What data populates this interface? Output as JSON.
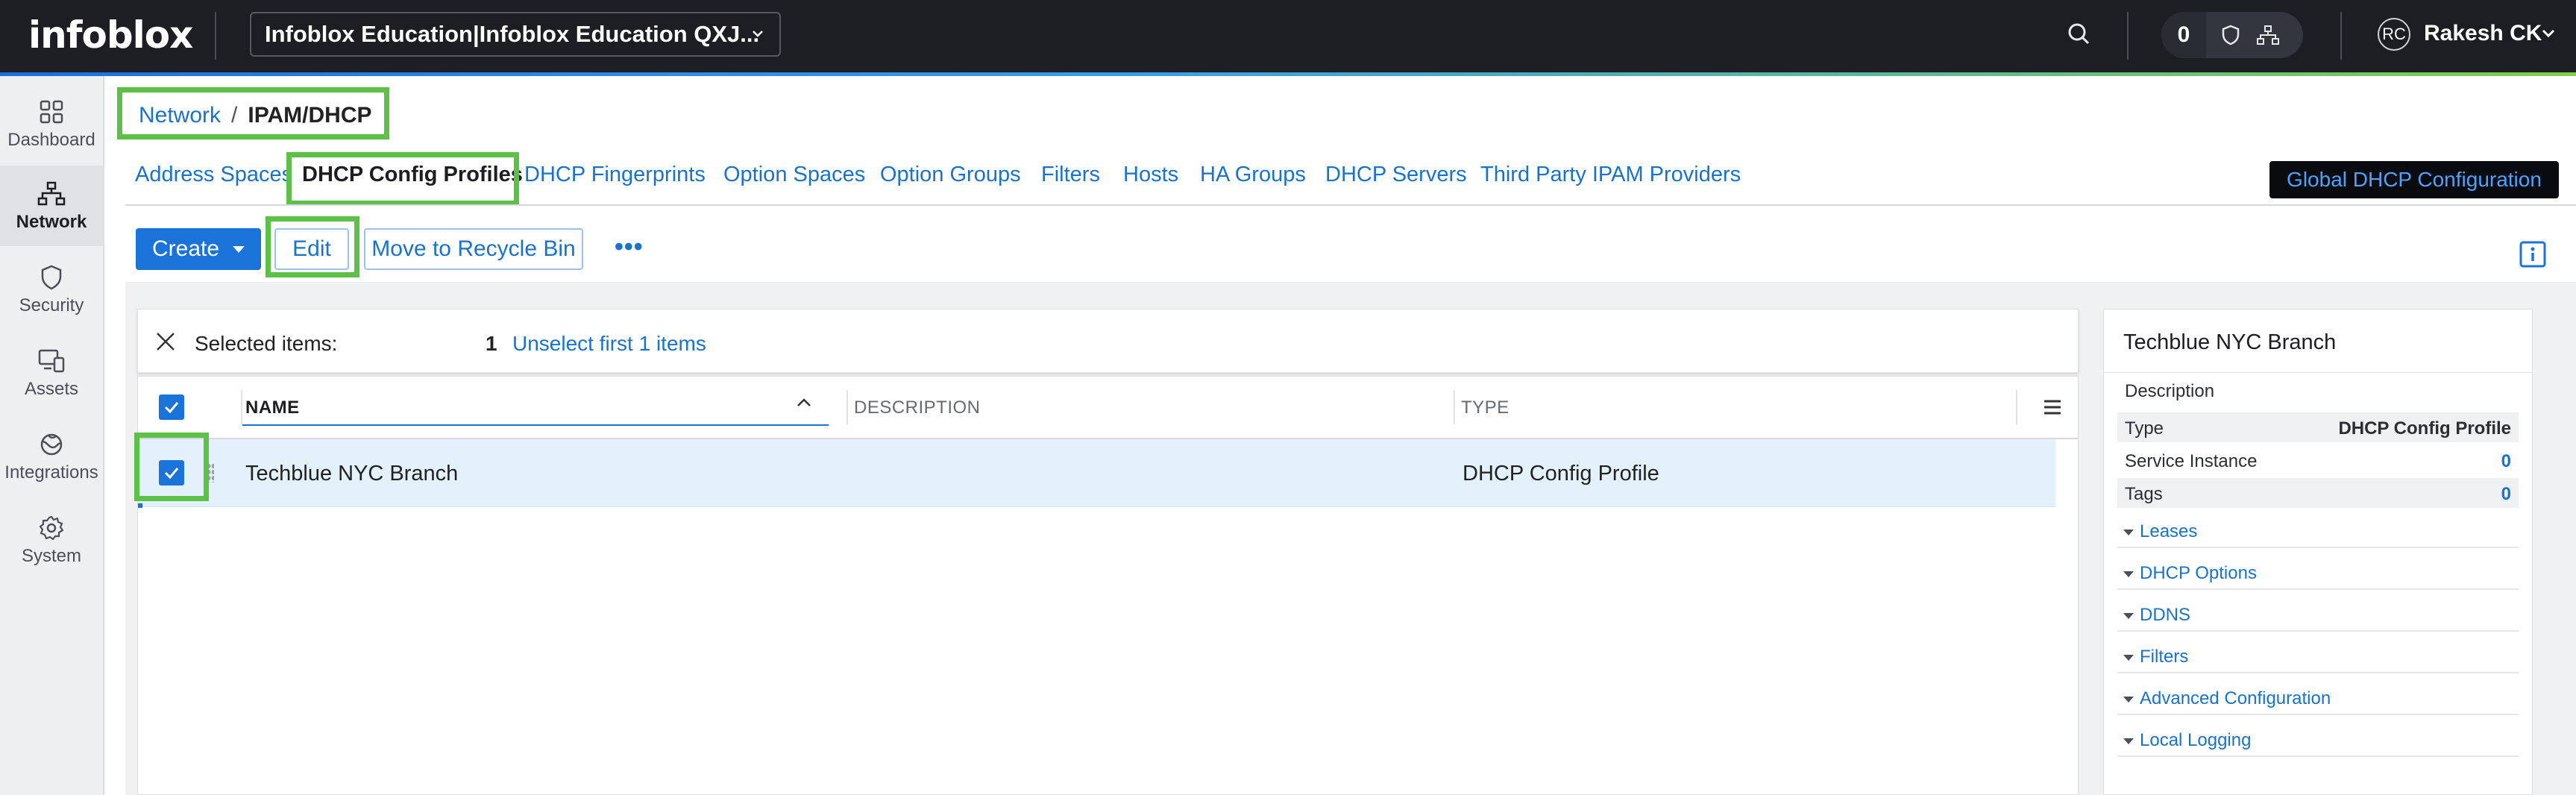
{
  "header": {
    "logo": "infoblox",
    "org_select": "Infoblox Education|Infoblox Education QXJ...",
    "status_count": "0",
    "avatar_initials": "RC",
    "user_name": "Rakesh CK"
  },
  "sidebar": {
    "items": [
      {
        "label": "Dashboard",
        "icon": "grid-icon"
      },
      {
        "label": "Network",
        "icon": "network-icon",
        "active": true
      },
      {
        "label": "Security",
        "icon": "shield-icon"
      },
      {
        "label": "Assets",
        "icon": "devices-icon"
      },
      {
        "label": "Integrations",
        "icon": "integrations-icon"
      },
      {
        "label": "System",
        "icon": "gear-icon"
      }
    ]
  },
  "breadcrumb": {
    "parent": "Network",
    "separator": "/",
    "current": "IPAM/DHCP"
  },
  "tabs": [
    {
      "label": "Address Spaces"
    },
    {
      "label": "DHCP Config Profiles",
      "active": true
    },
    {
      "label": "DHCP Fingerprints"
    },
    {
      "label": "Option Spaces"
    },
    {
      "label": "Option Groups"
    },
    {
      "label": "Filters"
    },
    {
      "label": "Hosts"
    },
    {
      "label": "HA Groups"
    },
    {
      "label": "DHCP Servers"
    },
    {
      "label": "Third Party IPAM Providers"
    }
  ],
  "global_button": "Global DHCP Configuration",
  "toolbar": {
    "create_label": "Create",
    "edit_label": "Edit",
    "recycle_label": "Move to Recycle Bin",
    "more_label": "•••"
  },
  "selection": {
    "label": "Selected items:",
    "count": "1",
    "unselect": "Unselect first 1 items"
  },
  "table": {
    "columns": [
      "NAME",
      "DESCRIPTION",
      "TYPE"
    ],
    "rows": [
      {
        "name": "Techblue NYC Branch",
        "description": "",
        "type": "DHCP Config Profile",
        "selected": true
      }
    ]
  },
  "details": {
    "title": "Techblue NYC Branch",
    "description_label": "Description",
    "fields": [
      {
        "label": "Type",
        "value": "DHCP Config Profile"
      },
      {
        "label": "Service Instance",
        "value": "0"
      },
      {
        "label": "Tags",
        "value": "0"
      }
    ],
    "sections": [
      "Leases",
      "DHCP Options",
      "DDNS",
      "Filters",
      "Advanced Configuration",
      "Local Logging"
    ]
  },
  "colors": {
    "accent": "#1a73d9",
    "highlight": "#5dc049",
    "topbar": "#1c1e24"
  }
}
